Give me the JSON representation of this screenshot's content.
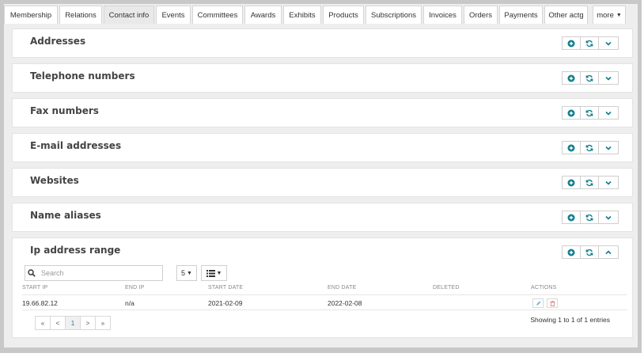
{
  "tabs": [
    {
      "label": "Membership"
    },
    {
      "label": "Relations"
    },
    {
      "label": "Contact info"
    },
    {
      "label": "Events"
    },
    {
      "label": "Committees"
    },
    {
      "label": "Awards"
    },
    {
      "label": "Exhibits"
    },
    {
      "label": "Products"
    },
    {
      "label": "Subscriptions"
    },
    {
      "label": "Invoices"
    },
    {
      "label": "Orders"
    },
    {
      "label": "Payments"
    },
    {
      "label": "Other actg"
    }
  ],
  "more_label": "more",
  "active_tab": "Contact info",
  "sections": [
    {
      "title": "Addresses"
    },
    {
      "title": "Telephone numbers"
    },
    {
      "title": "Fax numbers"
    },
    {
      "title": "E-mail addresses"
    },
    {
      "title": "Websites"
    },
    {
      "title": "Name aliases"
    },
    {
      "title": "Ip address range"
    }
  ],
  "ip_table": {
    "search_placeholder": "Search",
    "page_size": "5",
    "columns": [
      "START IP",
      "END IP",
      "START DATE",
      "END DATE",
      "DELETED",
      "ACTIONS"
    ],
    "rows": [
      {
        "start_ip": "19.66.82.12",
        "end_ip": "n/a",
        "start_date": "2021-02-09",
        "end_date": "2022-02-08",
        "deleted": ""
      }
    ],
    "pagination": {
      "first": "«",
      "prev": "<",
      "current": "1",
      "next": ">",
      "last": "»"
    },
    "showing_text": "Showing 1 to 1 of 1 entries"
  },
  "colors": {
    "accent": "#0e7d8c"
  },
  "icons": {
    "add": "plus-circle-icon",
    "refresh": "refresh-icon",
    "collapse": "chevron-icon",
    "search": "search-icon",
    "columns": "list-columns-icon",
    "edit": "pencil-icon",
    "delete": "trash-icon"
  }
}
